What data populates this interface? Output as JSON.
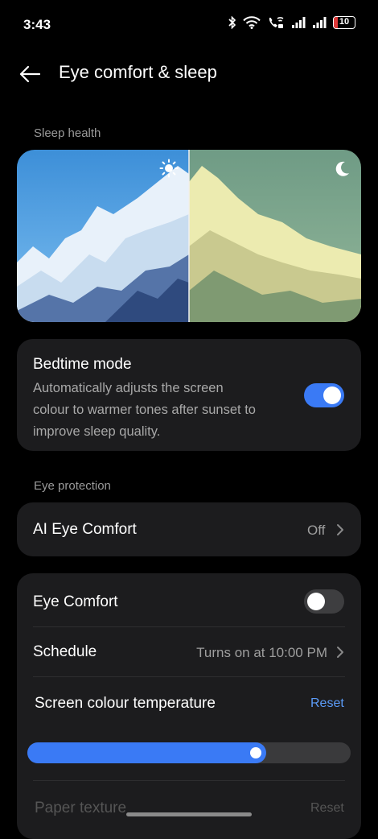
{
  "status_bar": {
    "time": "3:43",
    "battery": "10",
    "icons": [
      "bluetooth-icon",
      "wifi-icon",
      "wifi-calling-icon",
      "signal-icon",
      "signal-icon",
      "battery-icon"
    ]
  },
  "header": {
    "back_icon": "arrow-left-icon",
    "title": "Eye comfort & sleep"
  },
  "sleep_health": {
    "section_label": "Sleep health",
    "day_icon": "sun-icon",
    "night_icon": "moon-icon"
  },
  "bedtime": {
    "title": "Bedtime mode",
    "description_lines": [
      "Automatically adjusts the screen",
      "colour to warmer tones after sunset to",
      "improve sleep quality."
    ],
    "enabled": true
  },
  "eye_protection": {
    "section_label": "Eye protection",
    "ai_eye_comfort": {
      "title": "AI Eye Comfort",
      "value": "Off"
    },
    "eye_comfort": {
      "title": "Eye Comfort",
      "enabled": false
    },
    "schedule": {
      "title": "Schedule",
      "value": "Turns on at 10:00 PM"
    },
    "screen_temp": {
      "title": "Screen colour temperature",
      "reset": "Reset",
      "level": 0.74
    },
    "paper_texture": {
      "title": "Paper texture",
      "reset": "Reset"
    }
  },
  "colors": {
    "accent": "#3a7af5",
    "card": "#1c1c1e",
    "background": "#000000",
    "reset_link": "#5b9bf7",
    "battery_low": "#e03a3a"
  }
}
